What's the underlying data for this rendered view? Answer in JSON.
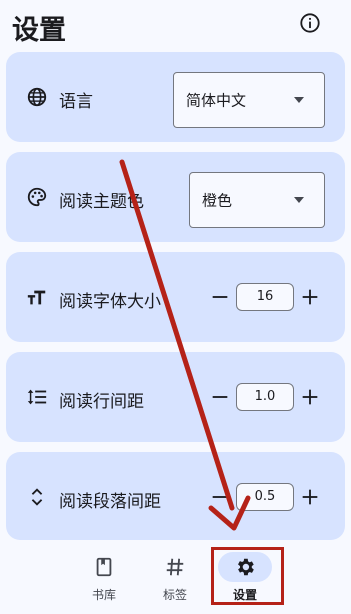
{
  "header": {
    "title": "设置",
    "info_icon": "info-icon"
  },
  "rows": {
    "language": {
      "label": "语言",
      "icon": "globe-icon",
      "value": "简体中文"
    },
    "theme_color": {
      "label": "阅读主题色",
      "icon": "palette-icon",
      "value": "橙色"
    },
    "font_size": {
      "label": "阅读字体大小",
      "icon": "text-size-icon",
      "value": "16"
    },
    "line_spacing": {
      "label": "阅读行间距",
      "icon": "line-spacing-icon",
      "value": "1.0"
    },
    "paragraph_spacing": {
      "label": "阅读段落间距",
      "icon": "unfold-icon",
      "value": "0.5"
    }
  },
  "stepper": {
    "minus": "−",
    "plus": "+"
  },
  "nav": [
    {
      "label": "书库",
      "icon": "book-icon",
      "active": false
    },
    {
      "label": "标签",
      "icon": "hashtag-icon",
      "active": false
    },
    {
      "label": "设置",
      "icon": "gear-icon",
      "active": true
    }
  ],
  "colors": {
    "accent_container": "#d7e3ff",
    "background": "#f7f9ff",
    "annotation": "#b52218"
  }
}
